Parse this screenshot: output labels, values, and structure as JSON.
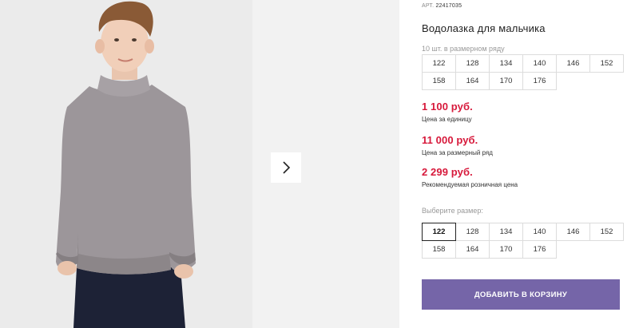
{
  "product": {
    "sku_label": "АРТ.",
    "sku": "22417035",
    "title": "Водолазка для мальчика"
  },
  "gallery": {
    "next_icon": "chevron-right-icon"
  },
  "pack": {
    "note": "10 шт. в размерном ряду",
    "sizes": [
      "122",
      "128",
      "134",
      "140",
      "146",
      "152",
      "158",
      "164",
      "170",
      "176"
    ]
  },
  "prices": [
    {
      "value": "1 100 руб.",
      "label": "Цена за единицу"
    },
    {
      "value": "11 000 руб.",
      "label": "Цена за размерный ряд"
    },
    {
      "value": "2 299 руб.",
      "label": "Рекомендуемая розничная цена"
    }
  ],
  "size_select": {
    "label": "Выберите размер:",
    "selected": "122",
    "sizes": [
      "122",
      "128",
      "134",
      "140",
      "146",
      "152",
      "158",
      "164",
      "170",
      "176"
    ]
  },
  "cart": {
    "button_label": "ДОБАВИТЬ В КОРЗИНУ"
  },
  "colors": {
    "price": "#d7193b",
    "button": "#7565a8",
    "sweater": "#9c969a"
  }
}
